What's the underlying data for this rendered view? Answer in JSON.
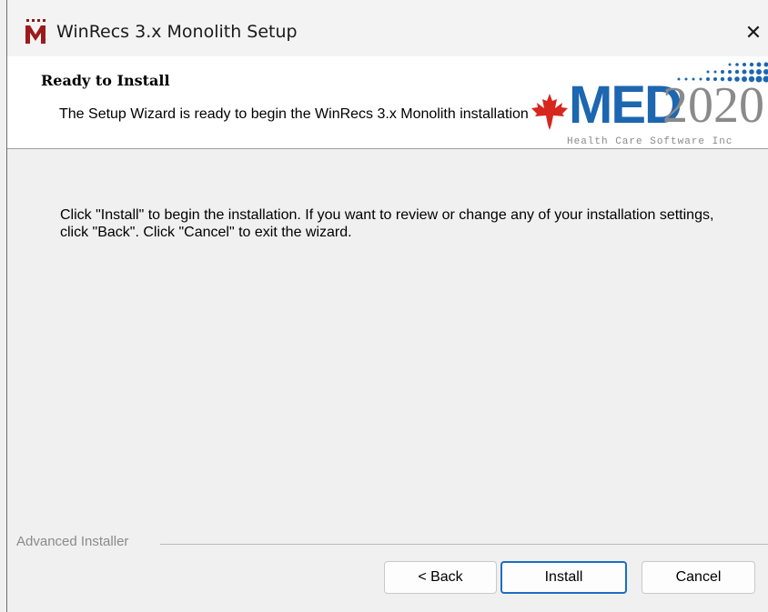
{
  "window": {
    "title": "WinRecs 3.x Monolith Setup",
    "close_symbol": "✕"
  },
  "banner": {
    "title": "Ready to Install",
    "description": "The Setup Wizard is ready to begin the WinRecs 3.x Monolith installation",
    "logo": {
      "brand_main": "MED",
      "brand_number": "2020",
      "tagline": "Health Care Software Inc",
      "colors": {
        "blue": "#1d66b0",
        "gray": "#8a8a8a",
        "red": "#d7261e"
      }
    }
  },
  "main": {
    "message": "Click \"Install\" to begin the installation.  If you want to review or change any of your installation settings, click \"Back\".  Click \"Cancel\" to exit the wizard."
  },
  "footer": {
    "branding": "Advanced Installer",
    "buttons": {
      "back": "< Back",
      "install": "Install",
      "cancel": "Cancel"
    }
  }
}
